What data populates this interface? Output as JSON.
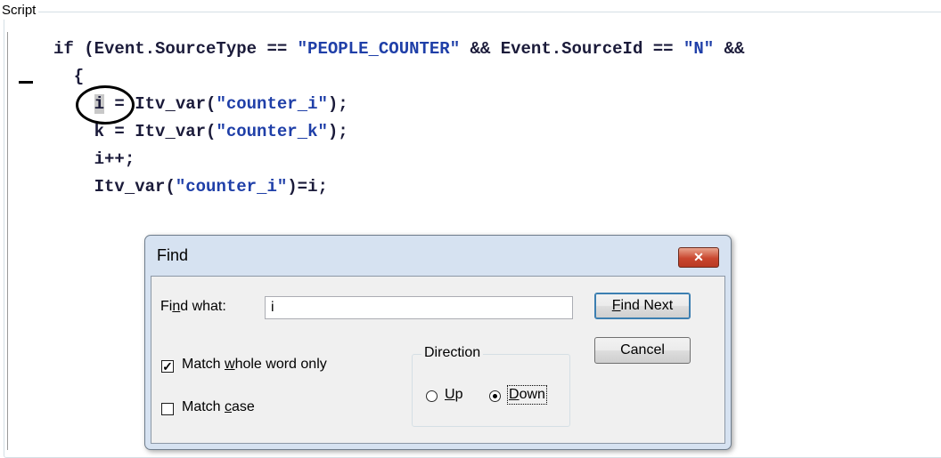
{
  "group": {
    "title": "Script"
  },
  "code": {
    "lines": [
      [
        {
          "t": "if (Event.SourceType == ",
          "c": ""
        },
        {
          "t": "\"PEOPLE",
          "c": "str"
        },
        {
          "t": " ",
          "c": "str ul"
        },
        {
          "t": "COUNTER\"",
          "c": "str"
        },
        {
          "t": " && Event.SourceId == ",
          "c": ""
        },
        {
          "t": "\"N\"",
          "c": "str"
        },
        {
          "t": " &&",
          "c": ""
        }
      ],
      [
        {
          "t": "  {",
          "c": ""
        }
      ],
      [
        {
          "t": "    ",
          "c": ""
        },
        {
          "t": "i",
          "c": "hl"
        },
        {
          "t": " = Itv",
          "c": ""
        },
        {
          "t": " ",
          "c": "ul"
        },
        {
          "t": "var(",
          "c": ""
        },
        {
          "t": "\"counter",
          "c": "str"
        },
        {
          "t": " ",
          "c": "str ul"
        },
        {
          "t": "i\"",
          "c": "str"
        },
        {
          "t": ");",
          "c": ""
        }
      ],
      [
        {
          "t": "    k = Itv",
          "c": ""
        },
        {
          "t": " ",
          "c": "ul"
        },
        {
          "t": "var(",
          "c": ""
        },
        {
          "t": "\"counter",
          "c": "str"
        },
        {
          "t": " ",
          "c": "str ul"
        },
        {
          "t": "k\"",
          "c": "str"
        },
        {
          "t": ");",
          "c": ""
        }
      ],
      [
        {
          "t": "    i++;",
          "c": ""
        }
      ],
      [
        {
          "t": "    Itv",
          "c": ""
        },
        {
          "t": " ",
          "c": "ul"
        },
        {
          "t": "var(",
          "c": ""
        },
        {
          "t": "\"counter",
          "c": "str"
        },
        {
          "t": " ",
          "c": "str ul"
        },
        {
          "t": "i\"",
          "c": "str"
        },
        {
          "t": ")=i;",
          "c": ""
        }
      ]
    ]
  },
  "dialog": {
    "title": "Find",
    "close_glyph": "✕",
    "find_what_label": "Find what:",
    "find_what_value": "i",
    "find_next_label": "Find Next",
    "cancel_label": "Cancel",
    "match_whole_word_label": "Match whole word only",
    "match_whole_word_checked": true,
    "match_case_label": "Match case",
    "match_case_checked": false,
    "direction_label": "Direction",
    "up_label": "Up",
    "down_label": "Down",
    "direction_selected": "down"
  },
  "colors": {
    "string": "#1f3fa8",
    "code_text": "#1b1b3a",
    "close_button": "#c9462e",
    "dialog_frame": "#d6e2f1"
  },
  "icons": {
    "close": "close-icon",
    "checkmark": "checkmark-icon"
  }
}
